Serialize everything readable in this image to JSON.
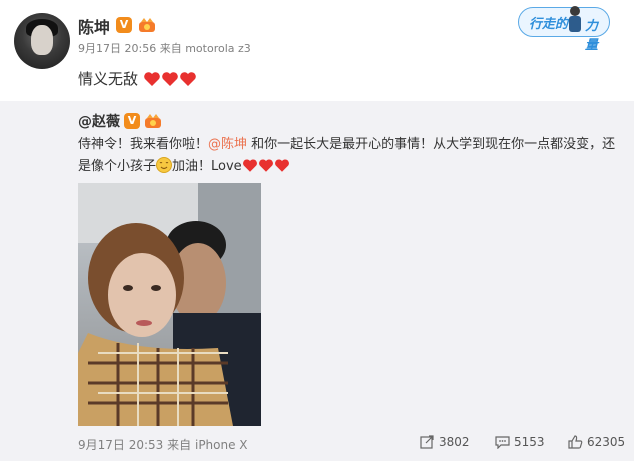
{
  "post": {
    "author": "陈坤",
    "verified_badge": "V",
    "time": "9月17日 20:56",
    "source_prefix": "来自",
    "source": "motorola z3",
    "text": "情义无敌",
    "hearts": 3
  },
  "slogan": {
    "part1": "行走的",
    "part2": "力量"
  },
  "repost": {
    "author": "@赵薇",
    "verified_badge": "V",
    "text_before_mention": "侍神令！我来看你啦！",
    "mention": "@陈坤",
    "text_after_mention": " 和你一起长大是最开心的事情！从大学到现在你一点都没变，还",
    "line2_before_emoji": "是像个小孩子",
    "line2_after_emoji": "加油！Love",
    "hearts": 3,
    "time": "9月17日 20:53",
    "source_prefix": "来自",
    "source": "iPhone X",
    "reposts": "3802",
    "comments": "5153",
    "likes": "62305"
  },
  "colors": {
    "accent_orange": "#eb7350",
    "badge_orange": "#f28c1c",
    "heart_red": "#e8312f",
    "repost_bg": "#f2f2f5",
    "meta_gray": "#808080"
  },
  "icons": [
    "verified-v-icon",
    "crown-icon",
    "heart-icon",
    "smile-emoji-icon",
    "share-icon",
    "comment-icon",
    "like-icon"
  ]
}
